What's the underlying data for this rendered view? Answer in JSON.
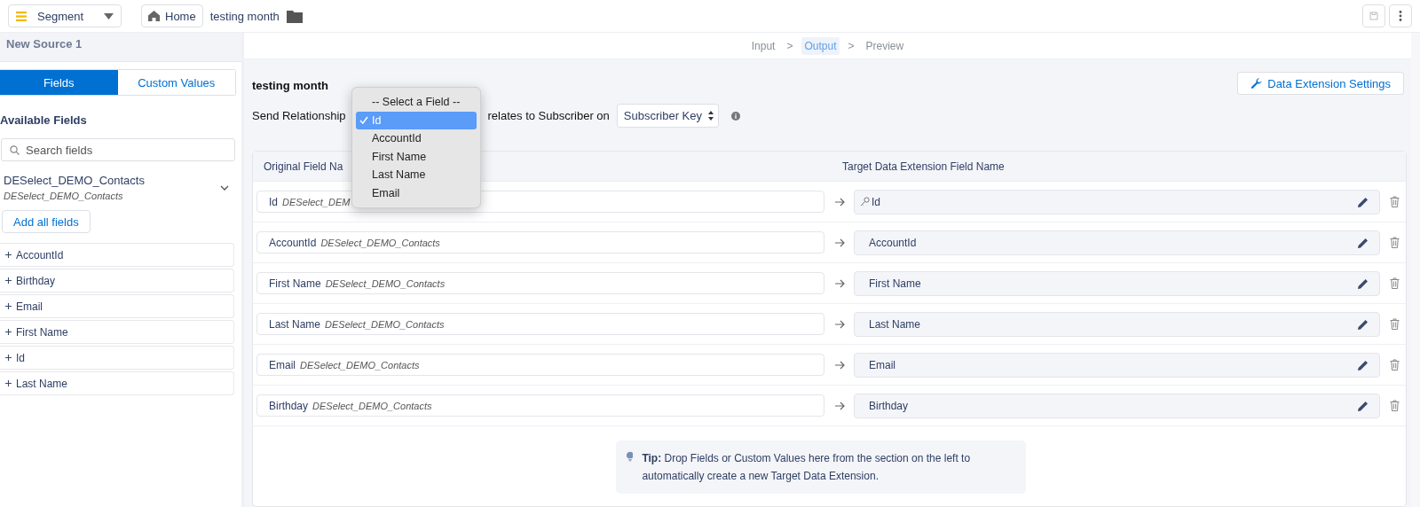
{
  "header": {
    "app_menu": "Segment",
    "home": "Home",
    "breadcrumb": "testing month"
  },
  "sidebar": {
    "title": "New Source 1",
    "tabs": [
      {
        "label": "Fields",
        "selected": true
      },
      {
        "label": "Custom Values",
        "selected": false
      }
    ],
    "section_title": "Available Fields",
    "search": {
      "placeholder": "Search fields"
    },
    "source": {
      "name": "DESelect_DEMO_Contacts",
      "subtitle": "DESelect_DEMO_Contacts"
    },
    "add_all": "Add all fields",
    "fields": [
      "AccountId",
      "Birthday",
      "Email",
      "First Name",
      "Id",
      "Last Name"
    ]
  },
  "steps": [
    {
      "label": "Input",
      "selected": false
    },
    {
      "separator": ">",
      "label": "Output",
      "selected": true
    },
    {
      "separator": ">",
      "label": "Preview",
      "selected": false
    }
  ],
  "output": {
    "title": "testing month",
    "relation_label": "Send Relationship",
    "relation_suffix": "relates to Subscriber on",
    "subscriber_select": "Subscriber Key",
    "settings_button": "Data Extension Settings",
    "columns": [
      "Original Field Na",
      "Target Data Extension Field Name"
    ],
    "rows": [
      {
        "field": "Id",
        "source": "DESelect_DEM",
        "target": "Id",
        "primary_key": true
      },
      {
        "field": "AccountId",
        "source": "DESelect_DEMO_Contacts",
        "target": "AccountId",
        "primary_key": false
      },
      {
        "field": "First Name",
        "source": "DESelect_DEMO_Contacts",
        "target": "First Name",
        "primary_key": false
      },
      {
        "field": "Last Name",
        "source": "DESelect_DEMO_Contacts",
        "target": "Last Name",
        "primary_key": false
      },
      {
        "field": "Email",
        "source": "DESelect_DEMO_Contacts",
        "target": "Email",
        "primary_key": false
      },
      {
        "field": "Birthday",
        "source": "DESelect_DEMO_Contacts",
        "target": "Birthday",
        "primary_key": false
      }
    ],
    "tip": "**Tip:** Drop Fields or Custom Values here from the section on the left to automatically create a new Target Data Extension."
  },
  "dropdown": {
    "options": [
      {
        "label": "-- Select a Field --",
        "selected": false
      },
      {
        "label": "Id",
        "selected": true
      },
      {
        "label": "AccountId",
        "selected": false
      },
      {
        "label": "First Name",
        "selected": false
      },
      {
        "label": "Last Name",
        "selected": false
      },
      {
        "label": "Email",
        "selected": false
      }
    ]
  }
}
